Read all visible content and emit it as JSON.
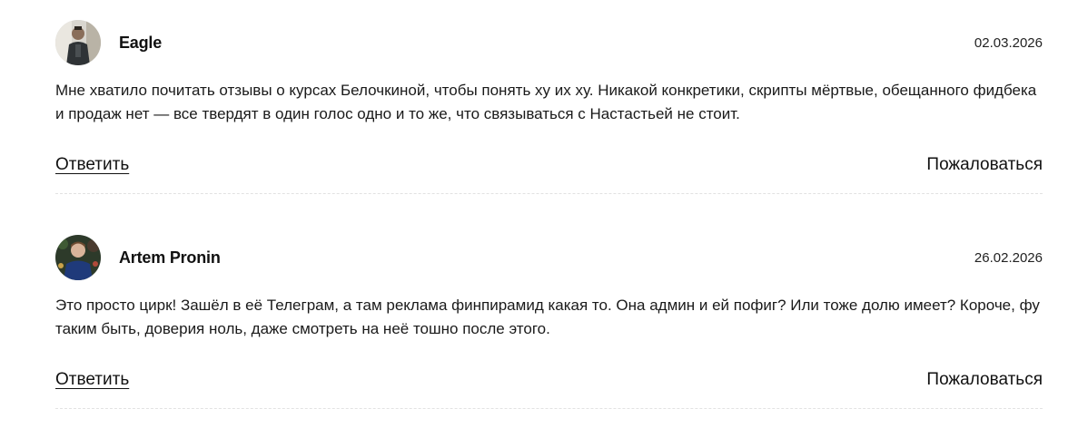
{
  "comments": [
    {
      "author": "Eagle",
      "date": "02.03.2026",
      "avatar_icon": "user-avatar-icon",
      "text": "Мне хватило почитать отзывы о курсах Белочкиной, чтобы понять ху их ху. Никакой конкретики, скрипты мёртвые, обещанного фидбека и продаж нет — все твердят в один голос одно и то же, что связываться с Настастьей не стоит.",
      "reply_label": "Ответить",
      "report_label": "Пожаловаться"
    },
    {
      "author": "Artem Pronin",
      "date": "26.02.2026",
      "avatar_icon": "user-avatar-icon",
      "text": "Это просто цирк! Зашёл в её Телеграм, а там реклама финпирамид какая то. Она админ и ей пофиг? Или тоже долю имеет? Короче, фу таким быть, доверия ноль, даже смотреть на неё тошно после этого.",
      "reply_label": "Ответить",
      "report_label": "Пожаловаться"
    }
  ]
}
